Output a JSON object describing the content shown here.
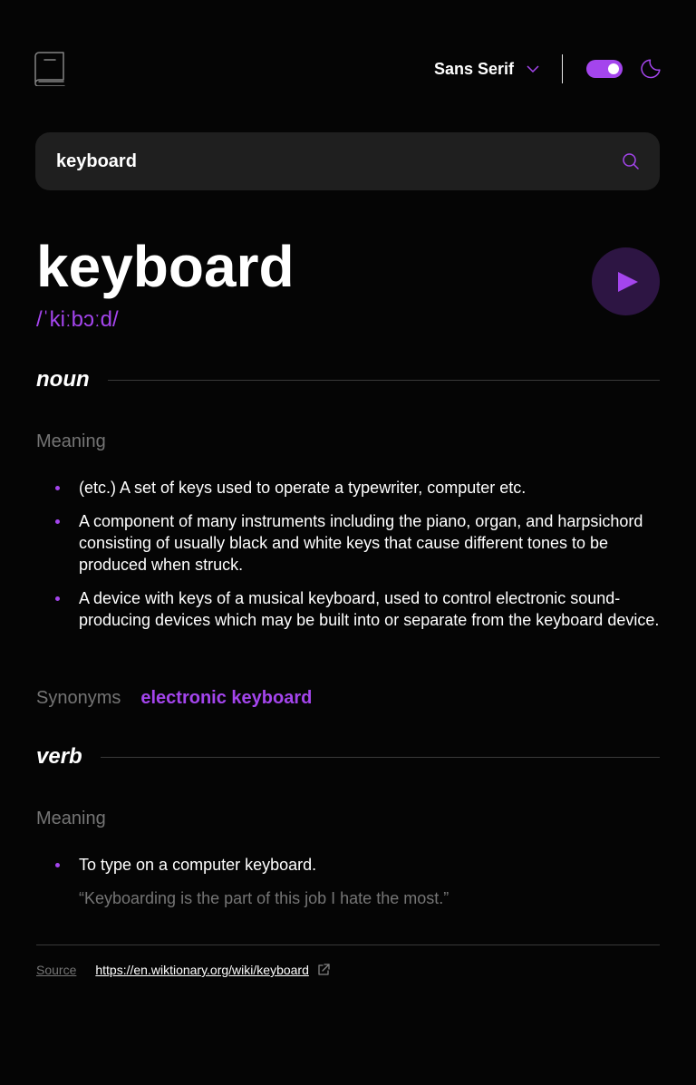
{
  "colors": {
    "accent": "#A445ED",
    "background": "#050505",
    "search_bg": "#1F1F1F",
    "muted": "#757575",
    "play_bg": "#2D1543"
  },
  "header": {
    "logo_icon": "book-icon",
    "font_selector": {
      "label": "Sans Serif",
      "icon": "chevron-down-icon"
    },
    "theme_toggle": {
      "state": "on",
      "icon": "moon-icon"
    }
  },
  "search": {
    "value": "keyboard",
    "icon": "search-icon"
  },
  "entry": {
    "word": "keyboard",
    "phonetic": "/ˈkiːbɔːd/",
    "play_icon": "play-icon"
  },
  "meanings": [
    {
      "part_of_speech": "noun",
      "label": "Meaning",
      "definitions": [
        "(etc.) A set of keys used to operate a typewriter, computer etc.",
        "A component of many instruments including the piano, organ, and harpsichord consisting of usually black and white keys that cause different tones to be produced when struck.",
        "A device with keys of a musical keyboard, used to control electronic sound-producing devices which may be built into or separate from the keyboard device."
      ],
      "synonyms_label": "Synonyms",
      "synonyms": [
        "electronic keyboard"
      ]
    },
    {
      "part_of_speech": "verb",
      "label": "Meaning",
      "definitions": [
        "To type on a computer keyboard."
      ],
      "example": "“Keyboarding is the part of this job I hate the most.”"
    }
  ],
  "footer": {
    "source_label": "Source",
    "source_url": "https://en.wiktionary.org/wiki/keyboard",
    "link_icon": "external-link-icon"
  }
}
